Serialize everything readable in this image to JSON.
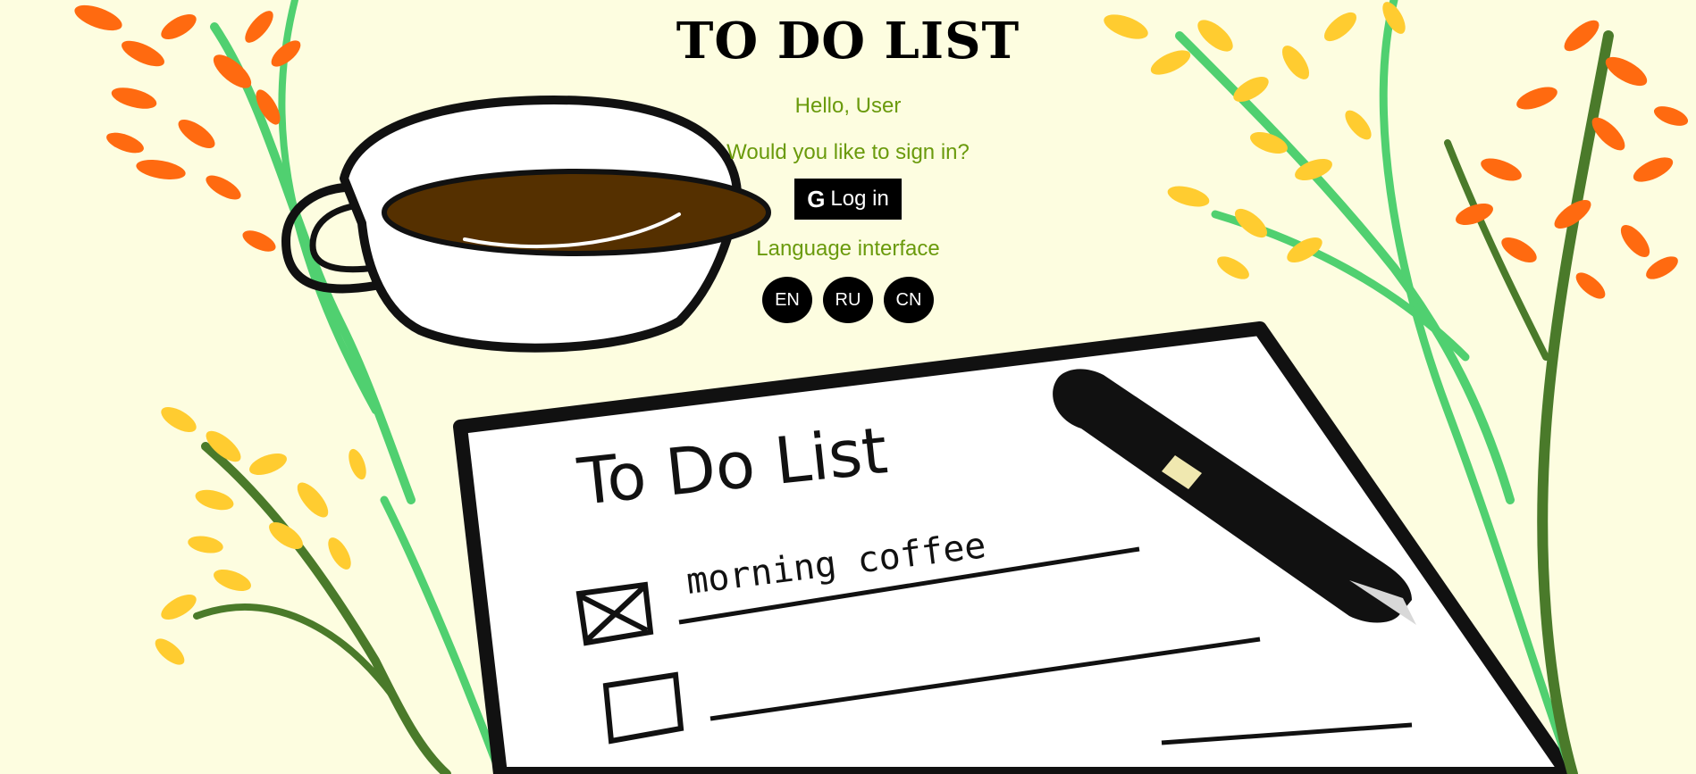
{
  "app": {
    "title": "TO DO LIST",
    "greeting": "Hello, User",
    "signin_prompt": "Would you like to sign in?",
    "login_button": {
      "icon": "google-g-icon",
      "icon_glyph": "G",
      "label": "Log in"
    },
    "language_label": "Language interface",
    "languages": [
      {
        "code": "EN"
      },
      {
        "code": "RU"
      },
      {
        "code": "CN"
      }
    ]
  },
  "illustration": {
    "notepad_heading": "To Do List",
    "notepad_item": "morning coffee"
  },
  "colors": {
    "background": "#fdfde0",
    "accent_text": "#6a9a0c",
    "button": "#000000",
    "coffee": "#553000",
    "orange_flowers": "#ff6a10",
    "yellow_flowers": "#ffcc30",
    "stem_light": "#50d070",
    "stem_dark": "#4a7a2a"
  }
}
